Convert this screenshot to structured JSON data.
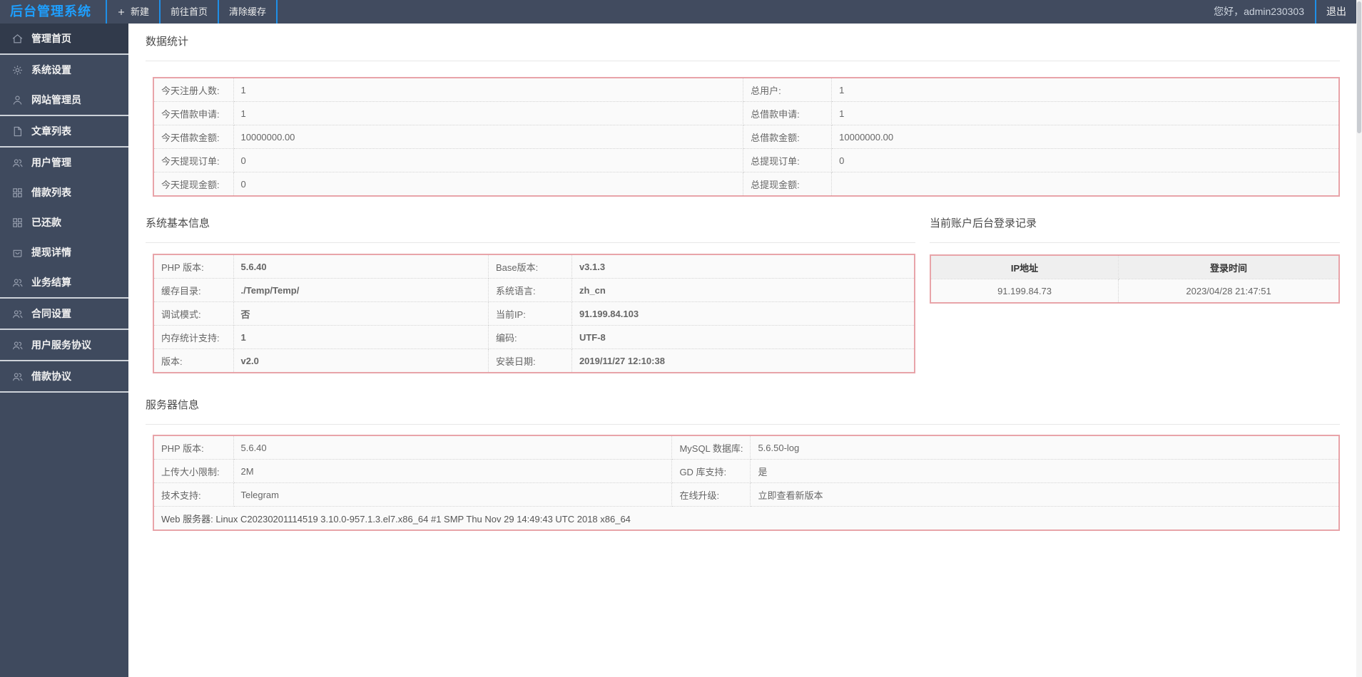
{
  "topbar": {
    "logo": "后台管理系统",
    "nav": [
      "新建",
      "前往首页",
      "清除缓存"
    ],
    "greeting": "您好，admin230303",
    "logout": "退出"
  },
  "sidebar": {
    "items": [
      {
        "key": "dashboard",
        "label": "管理首页",
        "icon": "home-icon",
        "active": true
      },
      {
        "key": "system-settings",
        "label": "系统设置",
        "icon": "gear-icon",
        "active": false
      },
      {
        "key": "site-admin",
        "label": "网站管理员",
        "icon": "user-icon",
        "active": false
      },
      {
        "key": "article-list",
        "label": "文章列表",
        "icon": "file-icon",
        "active": false
      },
      {
        "key": "user-management",
        "label": "用户管理",
        "icon": "users-icon",
        "active": false
      },
      {
        "key": "loan-list",
        "label": "借款列表",
        "icon": "grid-icon",
        "active": false
      },
      {
        "key": "repaid",
        "label": "已还款",
        "icon": "grid-icon",
        "active": false
      },
      {
        "key": "withdrawal-details",
        "label": "提现详情",
        "icon": "bag-icon",
        "active": false
      },
      {
        "key": "business-settlement",
        "label": "业务结算",
        "icon": "users-icon",
        "active": false
      },
      {
        "key": "contract-settings",
        "label": "合同设置",
        "icon": "users-icon",
        "active": false
      },
      {
        "key": "user-service-agreement",
        "label": "用户服务协议",
        "icon": "users-icon",
        "active": false
      },
      {
        "key": "loan-agreement",
        "label": "借款协议",
        "icon": "users-icon",
        "active": false
      }
    ]
  },
  "sections": {
    "stats": {
      "title": "数据统计",
      "rows": [
        [
          "今天注册人数:",
          "1",
          "总用户:",
          "1"
        ],
        [
          "今天借款申请:",
          "1",
          "总借款申请:",
          "1"
        ],
        [
          "今天借款金额:",
          "10000000.00",
          "总借款金额:",
          "10000000.00"
        ],
        [
          "今天提现订单:",
          "0",
          "总提现订单:",
          "0"
        ],
        [
          "今天提现金额:",
          "0",
          "总提现金额:",
          ""
        ]
      ]
    },
    "basic": {
      "title": "系统基本信息",
      "rows": [
        [
          "PHP 版本:",
          "5.6.40",
          "Base版本:",
          "v3.1.3"
        ],
        [
          "缓存目录:",
          "./Temp/Temp/",
          "系统语言:",
          "zh_cn"
        ],
        [
          "调试模式:",
          "否",
          "当前IP:",
          "91.199.84.103"
        ],
        [
          "内存统计支持:",
          "1",
          "编码:",
          "UTF-8"
        ],
        [
          "版本:",
          "v2.0",
          "安装日期:",
          "2019/11/27 12:10:38"
        ]
      ]
    },
    "login": {
      "title": "当前账户后台登录记录",
      "headers": [
        "IP地址",
        "登录时间"
      ],
      "rows": [
        [
          "91.199.84.73",
          "2023/04/28 21:47:51"
        ]
      ]
    },
    "server": {
      "title": "服务器信息",
      "rows": [
        [
          "PHP 版本:",
          "5.6.40",
          "MySQL 数据库:",
          "5.6.50-log"
        ],
        [
          "上传大小限制:",
          "2M",
          "GD 库支持:",
          "是"
        ],
        [
          "技术支持:",
          "Telegram",
          "在线升级:",
          "立即查看新版本"
        ]
      ],
      "footer": "Web 服务器: Linux C20230201114519 3.10.0-957.1.3.el7.x86_64 #1 SMP Thu Nov 29 14:49:43 UTC 2018 x86_64"
    }
  },
  "colors": {
    "accent_blue": "#1e9fff",
    "table_border_red": "#e8a4a9",
    "topbar_bg": "#414b5f",
    "sidebar_bg": "#3f4a5e",
    "sidebar_active_bg": "#313a4b"
  }
}
